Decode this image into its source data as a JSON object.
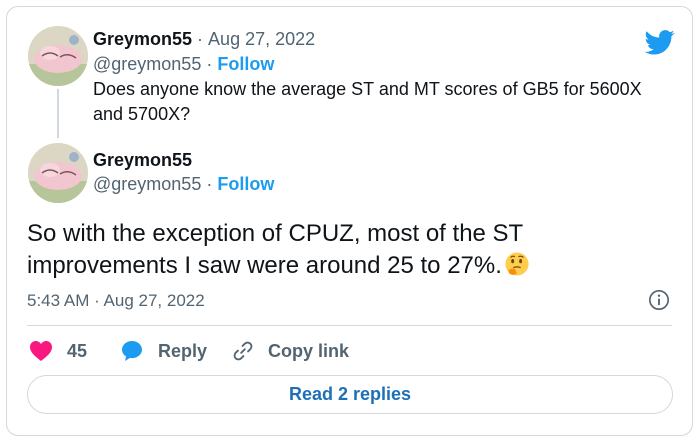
{
  "reply_tweet": {
    "author_name": "Greymon55",
    "date": "Aug 27, 2022",
    "handle": "@greymon55",
    "follow_label": "Follow",
    "text": "Does anyone know the average ST and MT scores of GB5 for 5600X and 5700X?"
  },
  "main_tweet": {
    "author_name": "Greymon55",
    "handle": "@greymon55",
    "follow_label": "Follow",
    "text": "So with the exception of CPUZ, most of the ST improvements I saw were around 25 to 27%.",
    "emoji": "thinking-face",
    "timestamp": "5:43 AM · Aug 27, 2022"
  },
  "actions": {
    "like_count": "45",
    "reply_label": "Reply",
    "copy_link_label": "Copy link"
  },
  "read_replies_label": "Read 2 replies",
  "separator": "·",
  "colors": {
    "twitter_blue": "#1d9bf0",
    "like_red": "#f91880",
    "muted": "#536471",
    "border": "#cfd9de"
  }
}
